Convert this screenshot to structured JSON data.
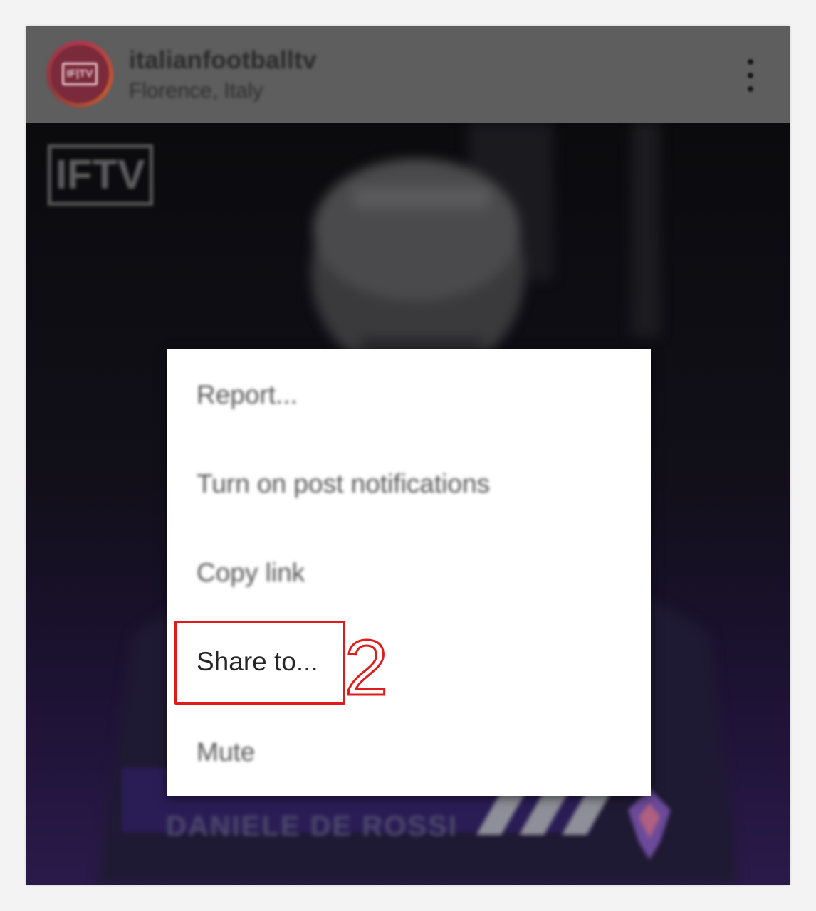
{
  "header": {
    "username": "italianfootballtv",
    "location": "Florence, Italy",
    "avatar_text": "IF|TV",
    "more_icon": "more-vertical-icon"
  },
  "media": {
    "watermark": "IFTV",
    "banner_name": "DANIELE DE ROSSI"
  },
  "menu": {
    "items": [
      {
        "label": "Report..."
      },
      {
        "label": "Turn on post notifications"
      },
      {
        "label": "Copy link"
      },
      {
        "label": "Share to..."
      },
      {
        "label": "Mute"
      }
    ]
  },
  "annotation": {
    "step": "2",
    "color": "#e01b1b"
  },
  "colors": {
    "header_bg": "#5e5e5e",
    "media_bottom": "#2a1a4a",
    "menu_bg": "#ffffff"
  }
}
